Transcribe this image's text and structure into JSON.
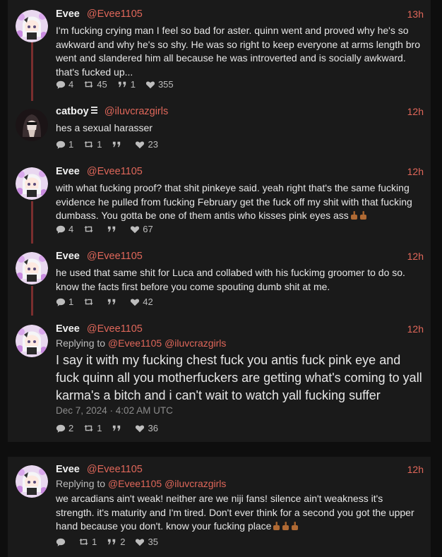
{
  "tweets": [
    {
      "name": "Evee",
      "handle": "@Evee1105",
      "time": "13h",
      "text": "I'm fucking crying man I feel so bad for aster. quinn went and proved why he's so awkward and why he's so shy. He was so right to keep everyone at arms length bro went and slandered him all because he was introverted and is socially awkward. that's fucked up...",
      "replies": "4",
      "retweets": "45",
      "quotes": "1",
      "likes": "355"
    },
    {
      "name": "catboy",
      "handle": "@iluvcrazgirls",
      "time": "12h",
      "text": "hes a sexual harasser",
      "replies": "1",
      "retweets": "1",
      "quotes": "",
      "likes": "23"
    },
    {
      "name": "Evee",
      "handle": "@Evee1105",
      "time": "12h",
      "text": "with what fucking proof? that shit pinkeye said. yeah right that's the same fucking evidence he pulled from fucking February get the fuck off my shit with that fucking dumbass. You gotta be one of them antis who kisses pink eyes ass",
      "replies": "4",
      "retweets": "",
      "quotes": "",
      "likes": "67"
    },
    {
      "name": "Evee",
      "handle": "@Evee1105",
      "time": "12h",
      "text": "he used that same shit for Luca and collabed with his fuckimg groomer to do so. know the facts first before you come spouting dumb shit at me.",
      "replies": "1",
      "retweets": "",
      "quotes": "",
      "likes": "42"
    },
    {
      "name": "Evee",
      "handle": "@Evee1105",
      "time": "12h",
      "replying_prefix": "Replying to",
      "replying_to1": "@Evee1105",
      "replying_to2": "@iluvcrazgirls",
      "text": "I say it with my fucking chest fuck you antis fuck pink eye and fuck quinn all you motherfuckers are getting what's coming to yall karma's a bitch and i can't wait to watch yall fucking suffer",
      "date": "Dec 7, 2024 · 4:02 AM UTC",
      "replies": "2",
      "retweets": "1",
      "quotes": "",
      "likes": "36"
    },
    {
      "name": "Evee",
      "handle": "@Evee1105",
      "time": "12h",
      "replying_prefix": "Replying to",
      "replying_to1": "@Evee1105",
      "replying_to2": "@iluvcrazgirls",
      "text": "we arcadians ain't weak! neither are we niji fans! silence ain't weakness it's strength. it's maturity and I'm tired. Don't ever think for a second you got the upper hand because you don't. know your fucking place",
      "replies": "",
      "retweets": "1",
      "quotes": "2",
      "likes": "35"
    }
  ],
  "colors": {
    "accent": "#e0675a",
    "thread_line": "#7a2e2e",
    "card": "#1a1a1a",
    "background": "#0e0e0e"
  }
}
